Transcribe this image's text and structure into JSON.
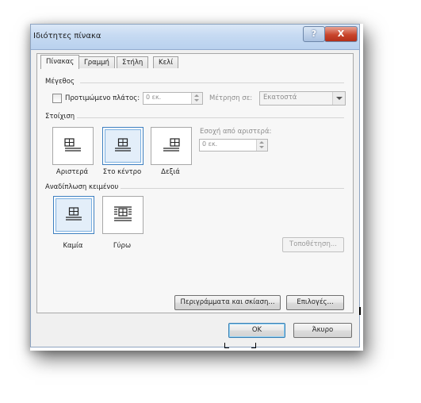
{
  "dialog": {
    "title": "Ιδιότητες πίνακα",
    "help_label": "?",
    "close_label": "X"
  },
  "tabs": [
    {
      "label": "Πίνακας",
      "active": true
    },
    {
      "label": "Γραμμή",
      "active": false
    },
    {
      "label": "Στήλη",
      "active": false
    },
    {
      "label": "Κελί",
      "active": false
    }
  ],
  "size": {
    "section_title": "Μέγεθος",
    "preferred_width_label": "Προτιμώμενο πλάτος:",
    "preferred_width_checked": false,
    "preferred_width_value": "0 εκ.",
    "measure_label": "Μέτρηση σε:",
    "measure_value": "Εκατοστά"
  },
  "alignment": {
    "section_title": "Στοίχιση",
    "options": [
      {
        "label": "Αριστερά",
        "selected": false
      },
      {
        "label": "Στο κέντρο",
        "selected": true
      },
      {
        "label": "Δεξιά",
        "selected": false
      }
    ],
    "indent_label": "Εσοχή από αριστερά:",
    "indent_value": "0 εκ."
  },
  "text_wrapping": {
    "section_title": "Αναδίπλωση κειμένου",
    "options": [
      {
        "label": "Καμία",
        "selected": true
      },
      {
        "label": "Γύρω",
        "selected": false
      }
    ],
    "positioning_label": "Τοποθέτηση..."
  },
  "buttons": {
    "borders_label": "Περιγράμματα και σκίαση...",
    "options_label": "Επιλογές...",
    "ok_label": "ΟΚ",
    "cancel_label": "Άκυρο"
  },
  "colors": {
    "titlebar": "#c6daf2",
    "selected_border": "#3d7fc0",
    "close_button": "#c8452c"
  }
}
